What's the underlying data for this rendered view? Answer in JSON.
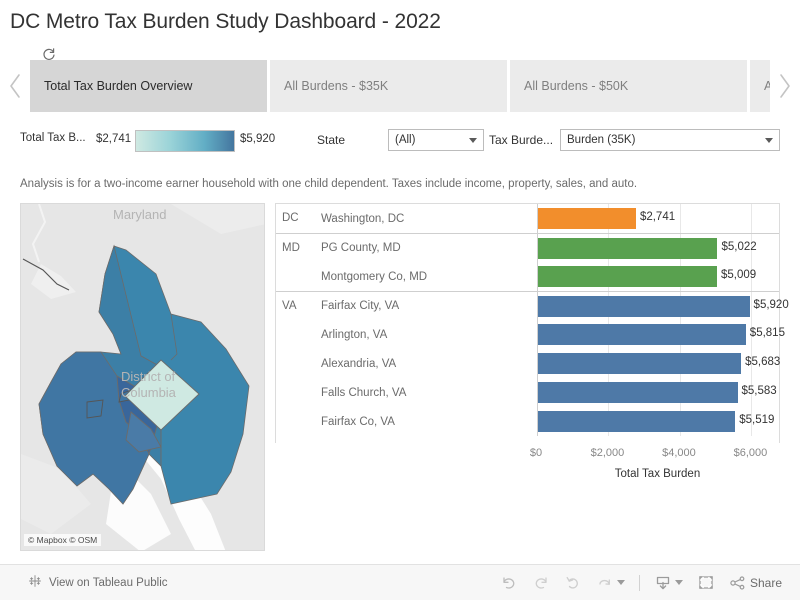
{
  "header": {
    "title": "DC Metro Tax Burden Study Dashboard - 2022",
    "reset_icon": "refresh-icon",
    "prev_icon": "chevron-left-icon",
    "next_icon": "chevron-right-icon"
  },
  "tabs": [
    {
      "label": "Total Tax Burden Overview",
      "active": true
    },
    {
      "label": "All Burdens - $35K",
      "active": false
    },
    {
      "label": "All Burdens - $50K",
      "active": false
    },
    {
      "label": "A",
      "active": false
    }
  ],
  "legend": {
    "title": "Total Tax B...",
    "min": "$2,741",
    "max": "$5,920",
    "color_start": "#cfe9e2",
    "color_end": "#44769f"
  },
  "filters": [
    {
      "label": "State",
      "value": "(All)"
    },
    {
      "label": "Tax Burde...",
      "value": "Burden (35K)"
    }
  ],
  "subtitle": "Analysis is for a two-income earner household with one child dependent. Taxes include income, property, sales, and auto.",
  "map": {
    "labels": {
      "state": "Maryland",
      "district": "District of\nColumbia"
    },
    "attribution": "© Mapbox  © OSM",
    "regions": [
      {
        "name": "montgomery-co-md",
        "color": "#3c7fa6"
      },
      {
        "name": "pg-county-md",
        "color": "#3b86ad"
      },
      {
        "name": "fairfax-co-va",
        "color": "#4076a3"
      },
      {
        "name": "district-of-columbia",
        "color": "#cfe9e2"
      },
      {
        "name": "arlington-va",
        "color": "#39669b"
      },
      {
        "name": "alexandria-va",
        "color": "#4a7ba7"
      },
      {
        "name": "falls-church-va",
        "color": "#4076a3"
      },
      {
        "name": "fairfax-city-va",
        "color": "#4076a3"
      }
    ]
  },
  "chart_data": {
    "type": "bar",
    "title": "",
    "xlabel": "Total Tax Burden",
    "ylabel": "",
    "orientation": "horizontal",
    "xlim": [
      0,
      6800
    ],
    "xticks": [
      "$0",
      "$2,000",
      "$4,000",
      "$6,000"
    ],
    "xtick_values": [
      0,
      2000,
      4000,
      6000
    ],
    "grid": true,
    "legend": "none",
    "group_header": "",
    "groups": [
      {
        "state": "DC",
        "rows": [
          {
            "jurisdiction": "Washington, DC",
            "value": 2741,
            "label": "$2,741",
            "color": "#f28e2c"
          }
        ]
      },
      {
        "state": "MD",
        "rows": [
          {
            "jurisdiction": "PG County, MD",
            "value": 5022,
            "label": "$5,022",
            "color": "#59a14f"
          },
          {
            "jurisdiction": "Montgomery Co, MD",
            "value": 5009,
            "label": "$5,009",
            "color": "#59a14f"
          }
        ]
      },
      {
        "state": "VA",
        "rows": [
          {
            "jurisdiction": "Fairfax City, VA",
            "value": 5920,
            "label": "$5,920",
            "color": "#4e79a7"
          },
          {
            "jurisdiction": "Arlington, VA",
            "value": 5815,
            "label": "$5,815",
            "color": "#4e79a7"
          },
          {
            "jurisdiction": "Alexandria, VA",
            "value": 5683,
            "label": "$5,683",
            "color": "#4e79a7"
          },
          {
            "jurisdiction": "Falls Church, VA",
            "value": 5583,
            "label": "$5,583",
            "color": "#4e79a7"
          },
          {
            "jurisdiction": "Fairfax Co, VA",
            "value": 5519,
            "label": "$5,519",
            "color": "#4e79a7"
          }
        ]
      }
    ]
  },
  "footer": {
    "tableau_label": "View on Tableau Public",
    "tableau_icon": "tableau-logo-icon",
    "undo_icon": "undo-icon",
    "redo_icon": "redo-icon",
    "revert_icon": "revert-icon",
    "refresh_icon": "refresh-data-icon",
    "download_icon": "download-icon",
    "fullscreen_icon": "fullscreen-icon",
    "share_icon": "share-icon",
    "share_label": "Share"
  }
}
